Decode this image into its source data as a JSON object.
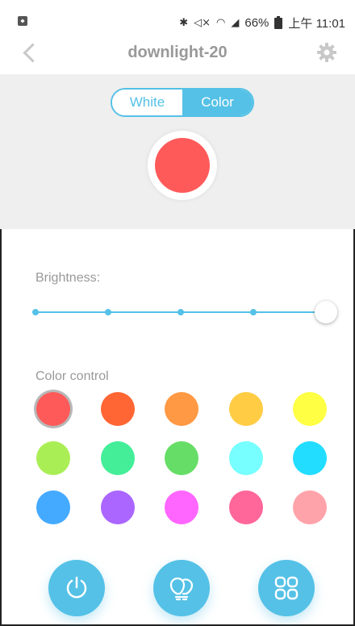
{
  "status_bar": {
    "icons": [
      "sim-icon",
      "bluetooth-icon",
      "mute-icon",
      "wifi-icon",
      "signal-icon",
      "battery-icon"
    ],
    "battery": "66%",
    "time": "上午 11:01"
  },
  "header": {
    "title": "downlight-20",
    "back_icon": "chevron-left-icon",
    "settings_icon": "gear-icon"
  },
  "mode_toggle": {
    "options": [
      "White",
      "Color"
    ],
    "selected": "Color"
  },
  "preview": {
    "color": "#ff5a5a"
  },
  "brightness": {
    "label": "Brightness:",
    "value_fraction": 1.0,
    "ticks": 5
  },
  "color_control": {
    "label": "Color control",
    "selected_index": 0,
    "swatches": [
      "#ff5a5a",
      "#ff6633",
      "#ff9944",
      "#ffcc44",
      "#ffff44",
      "#aaee55",
      "#44ee99",
      "#66dd66",
      "#77ffff",
      "#22ddff",
      "#44aaff",
      "#aa66ff",
      "#ff66ff",
      "#ff6699",
      "#ffa3aa"
    ]
  },
  "bottom_bar": {
    "buttons": [
      "power-icon",
      "bulbs-icon",
      "grid-icon"
    ]
  },
  "colors": {
    "accent": "#55c1e6",
    "panel_bg": "#efefef",
    "muted_text": "#999999"
  }
}
